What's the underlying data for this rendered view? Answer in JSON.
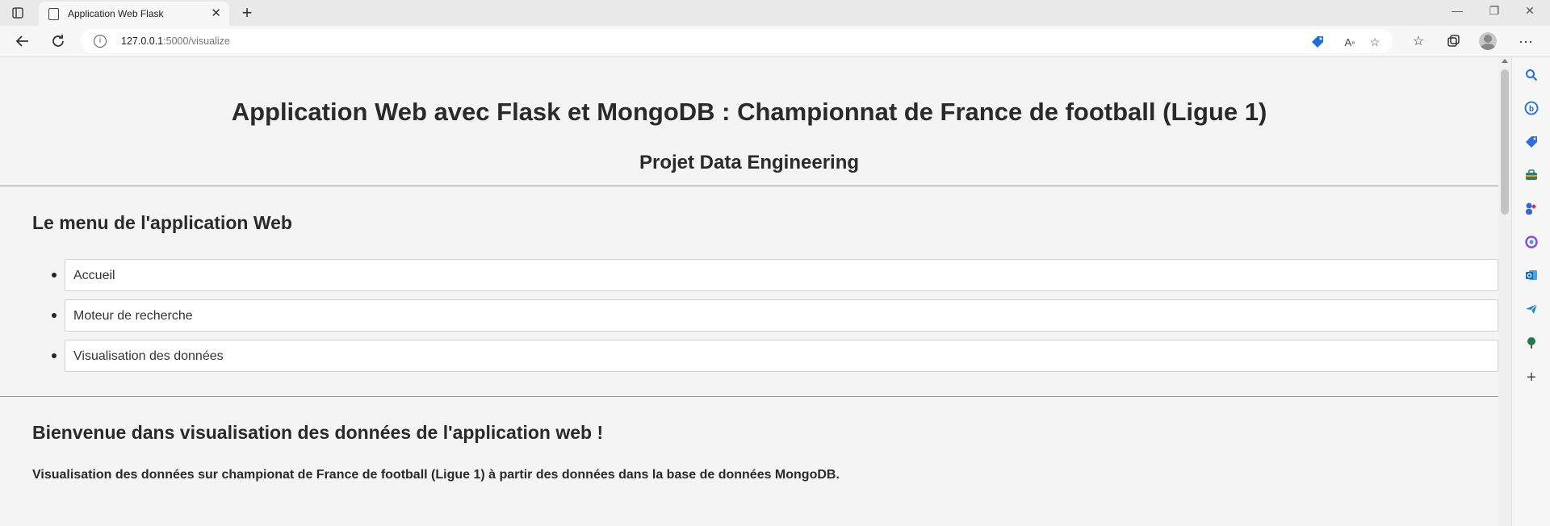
{
  "browser": {
    "tab_title": "Application Web Flask",
    "url_host": "127.0.0.1",
    "url_path": ":5000/visualize"
  },
  "page": {
    "title": "Application Web avec Flask et MongoDB : Championnat de France de football (Ligue 1)",
    "subtitle": "Projet Data Engineering",
    "menu_title": "Le menu de l'application Web",
    "menu_items": [
      {
        "label": "Accueil"
      },
      {
        "label": "Moteur de recherche"
      },
      {
        "label": "Visualisation des données"
      }
    ],
    "welcome_title": "Bienvenue dans visualisation des données de l'application web !",
    "description": "Visualisation des données sur championat de France de football (Ligue 1) à partir des données dans la base de données MongoDB."
  },
  "icons": {
    "tab_actions": "tab-actions-icon",
    "page": "page-icon",
    "close": "close-icon",
    "new_tab": "plus-icon",
    "back": "back-arrow-icon",
    "reload": "reload-icon",
    "info": "info-icon",
    "coupon": "tag-icon",
    "read_aloud": "read-aloud-icon",
    "add_favorite": "star-plus-icon",
    "favorites": "favorites-icon",
    "collections": "collections-icon",
    "profile": "avatar",
    "more": "more-icon"
  },
  "colors": {
    "page_background": "#f4f4f4",
    "sidebar_search": "#1a73e8",
    "sidebar_bing": "#1b6fd8",
    "sidebar_shopping": "#2f6fdd",
    "sidebar_tools": "#2f7d6a",
    "sidebar_games": "#3a66d9",
    "sidebar_office": "#8a4fd8",
    "sidebar_outlook": "#0f6cbd",
    "sidebar_send": "#1e88c7",
    "sidebar_tree": "#1e7b4a"
  }
}
